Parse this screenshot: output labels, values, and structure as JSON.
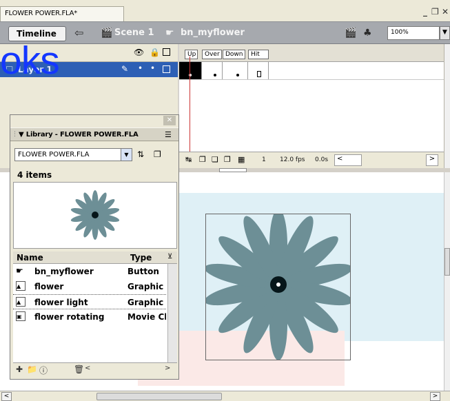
{
  "document_tab": "FLOWER POWER.FLA*",
  "window_controls": {
    "minimize": "_",
    "restore": "❐",
    "close": "✕"
  },
  "toolbar": {
    "timeline_button": "Timeline",
    "scene": "Scene 1",
    "symbol": "bn_myflower",
    "zoom": "100%"
  },
  "overlay_text": "oks",
  "timeline": {
    "layer_name": "Layer 1",
    "frame_labels": [
      "Up",
      "Over",
      "Down",
      "Hit"
    ],
    "status": {
      "frame": "1",
      "fps": "12.0 fps",
      "time": "0.0s"
    }
  },
  "library": {
    "title": "Library - FLOWER POWER.FLA",
    "selected_file": "FLOWER POWER.FLA",
    "item_count": "4 items",
    "columns": {
      "name": "Name",
      "type": "Type"
    },
    "items": [
      {
        "name": "bn_myflower",
        "type": "Button",
        "icon": "button-symbol-icon"
      },
      {
        "name": "flower",
        "type": "Graphic",
        "icon": "graphic-symbol-icon"
      },
      {
        "name": "flower light",
        "type": "Graphic",
        "icon": "graphic-symbol-icon"
      },
      {
        "name": "flower rotating",
        "type": "Movie Clip",
        "icon": "movieclip-symbol-icon"
      }
    ]
  },
  "colors": {
    "petal": "#6d8f96",
    "center": "#06161a",
    "selection": "#2d5fb5"
  }
}
